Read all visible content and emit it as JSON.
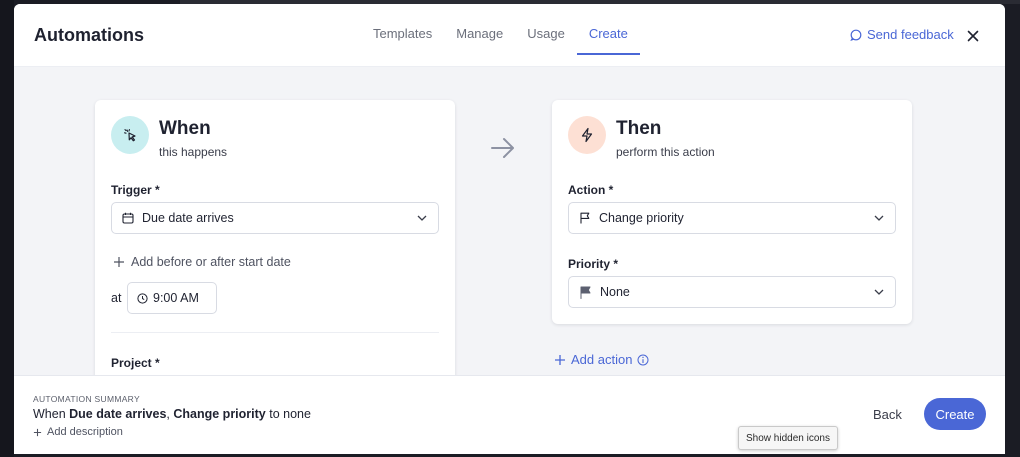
{
  "header": {
    "title": "Automations",
    "tabs": [
      "Templates",
      "Manage",
      "Usage",
      "Create"
    ],
    "active_tab": "Create",
    "feedback_label": "Send feedback"
  },
  "when_card": {
    "heading": "When",
    "subheading": "this happens",
    "icon": "cursor-click-icon",
    "trigger_label": "Trigger *",
    "trigger_value": "Due date arrives",
    "add_offset_label": "Add before or after start date",
    "at_label": "at",
    "time_value": "9:00 AM",
    "project_label": "Project *"
  },
  "then_card": {
    "heading": "Then",
    "subheading": "perform this action",
    "icon": "lightning-icon",
    "action_label": "Action *",
    "action_value": "Change priority",
    "priority_label": "Priority *",
    "priority_value": "None"
  },
  "add_action_label": "Add action",
  "footer": {
    "summary_caption": "AUTOMATION SUMMARY",
    "summary_prefix": "When ",
    "summary_trigger": "Due date arrives",
    "summary_sep": ", ",
    "summary_action": "Change priority",
    "summary_suffix": " to none",
    "add_description_label": "Add description",
    "back_label": "Back",
    "create_label": "Create"
  },
  "tooltip": "Show hidden icons",
  "colors": {
    "accent": "#4a67d6",
    "when_icon_bg": "#c8eef0",
    "then_icon_bg": "#fde0d4"
  }
}
